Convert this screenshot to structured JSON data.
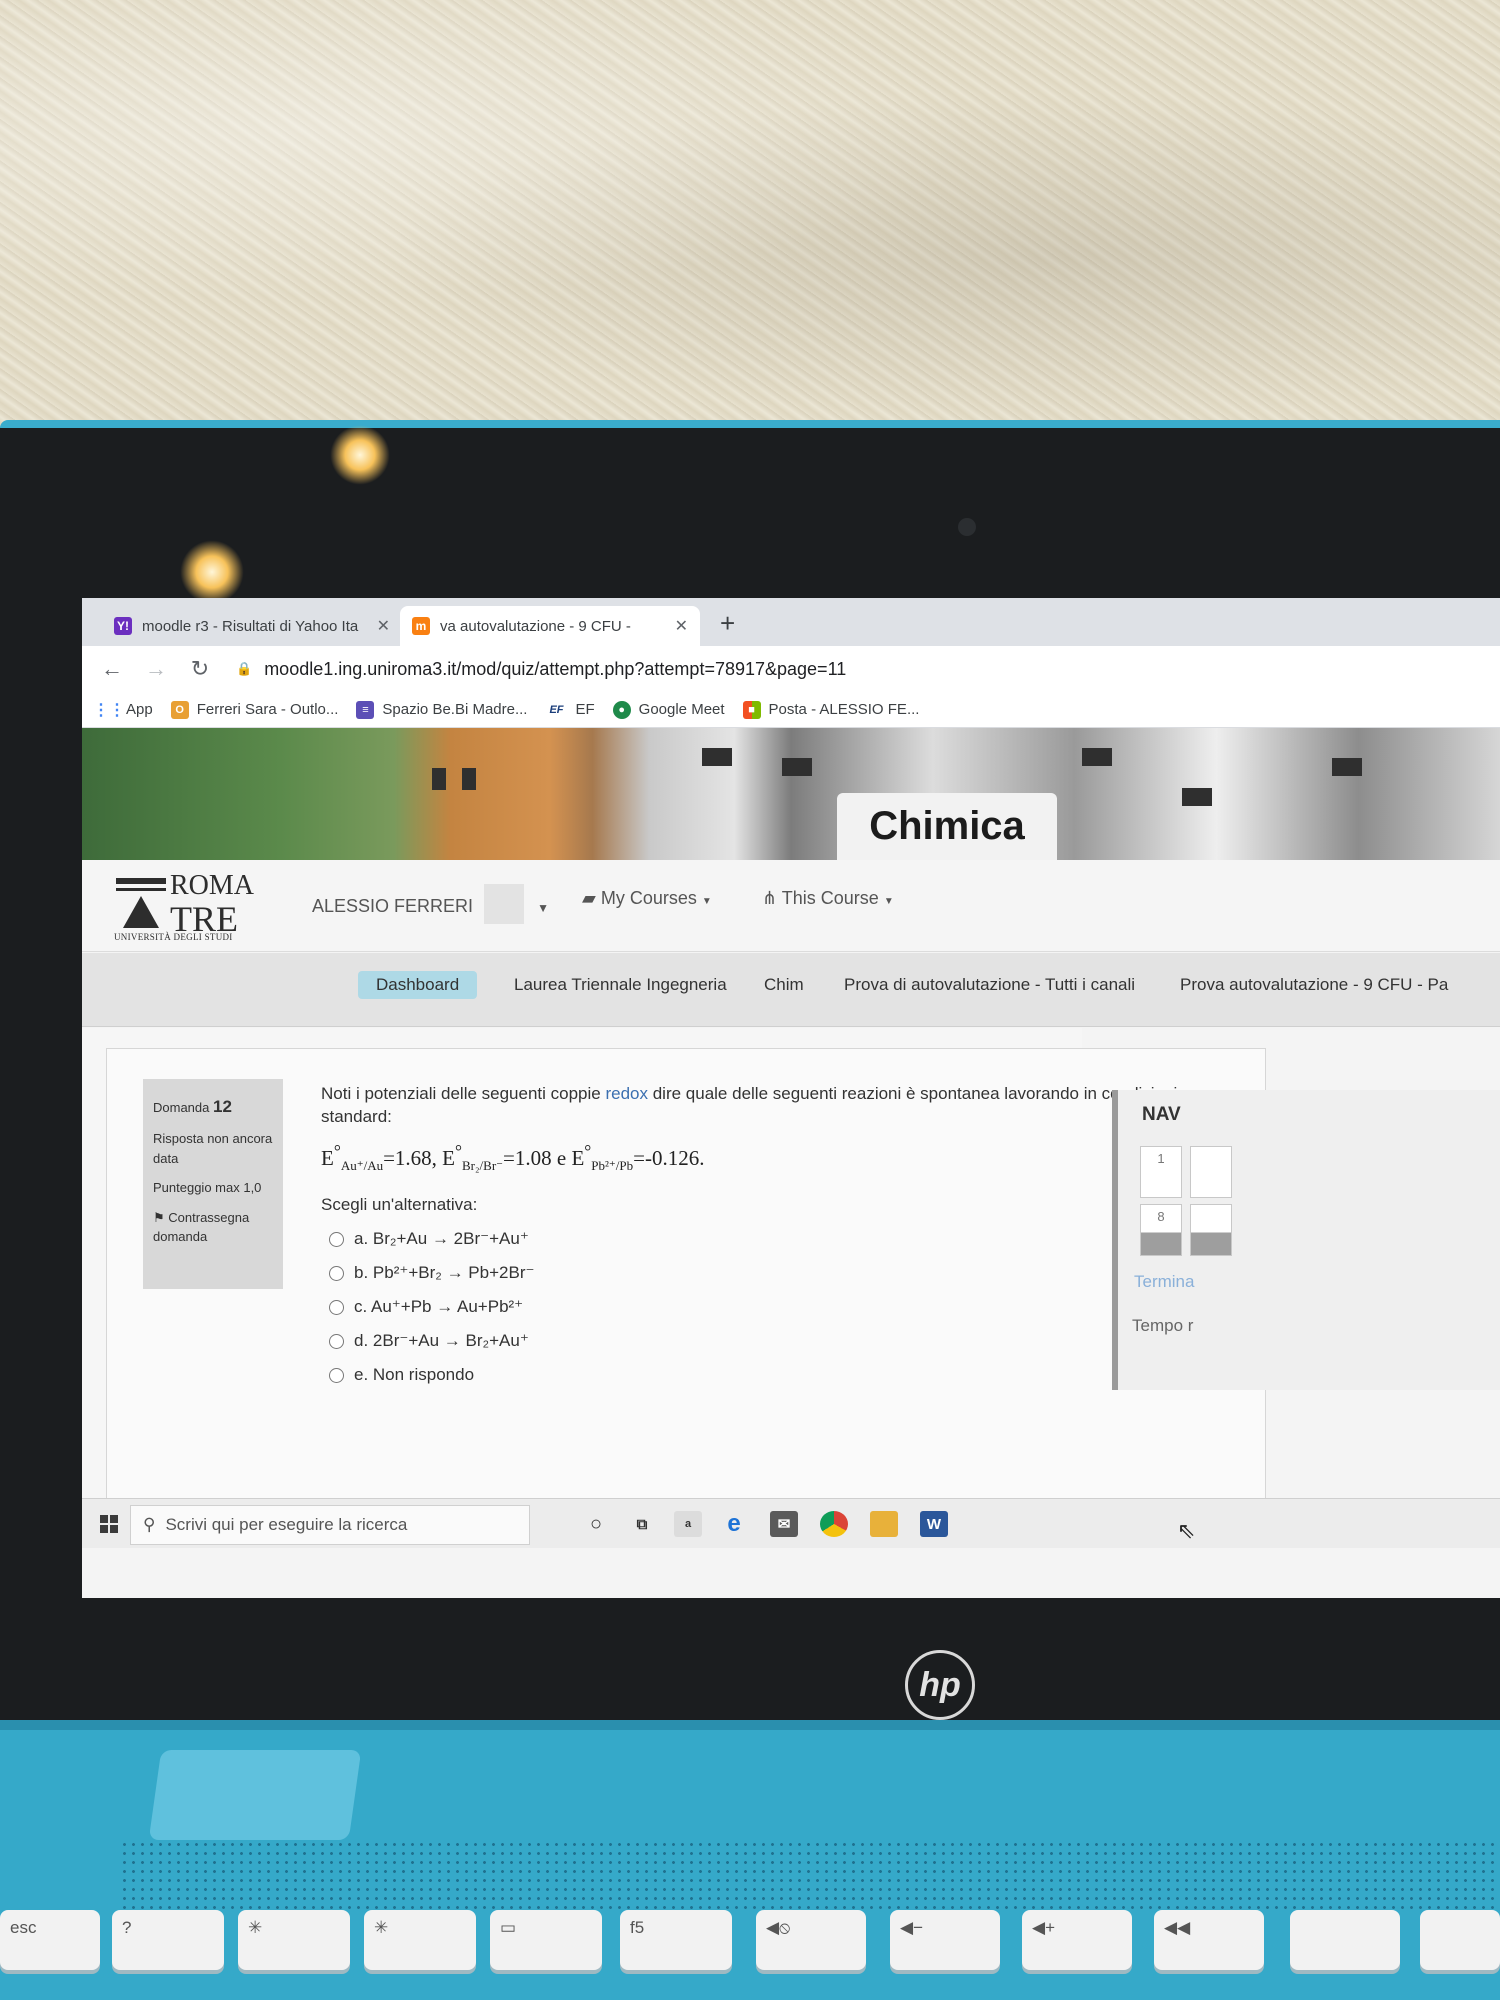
{
  "browser": {
    "tabs": [
      {
        "label": "moodle r3 - Risultati di Yahoo Ita",
        "favicon": "yahoo-icon"
      },
      {
        "label": "va autovalutazione - 9 CFU - ",
        "favicon": "moodle-icon"
      }
    ],
    "new_tab": "+",
    "url": "moodle1.ing.uniroma3.it/mod/quiz/attempt.php?attempt=78917&page=11",
    "bookmarks": [
      {
        "label": "App",
        "icon": "apps-grid-icon"
      },
      {
        "label": "Ferreri Sara - Outlo...",
        "icon": "outlook-icon"
      },
      {
        "label": "Spazio Be.Bi Madre...",
        "icon": "list-icon"
      },
      {
        "label": "EF",
        "icon": "ef-icon"
      },
      {
        "label": "Google Meet",
        "icon": "meet-icon"
      },
      {
        "label": "Posta - ALESSIO FE...",
        "icon": "microsoft-icon"
      }
    ]
  },
  "header": {
    "course_title": "Chimica",
    "logo": {
      "line1": "ROMA",
      "line2": "TRE",
      "sub": "UNIVERSITÀ DEGLI STUDI"
    },
    "user": "ALESSIO FERRERI",
    "my_courses": "My Courses",
    "this_course": "This Course"
  },
  "breadcrumb": [
    "Dashboard",
    "Laurea Triennale Ingegneria",
    "Chim",
    "Prova di autovalutazione - Tutti i canali",
    "Prova autovalutazione - 9 CFU - Pa"
  ],
  "question": {
    "label": "Domanda",
    "number": "12",
    "status": "Risposta non ancora data",
    "max_score": "Punteggio max 1,0",
    "flag": "Contrassegna domanda",
    "text_before": "Noti i potenziali delle seguenti coppie ",
    "text_link": "redox",
    "text_after": " dire quale delle seguenti reazioni è spontanea lavorando in condizioni standard:",
    "formula": {
      "e1_sub": "Au⁺/Au",
      "e1_val": "=1.68, ",
      "e2_sub": "Br₂/Br⁻",
      "e2_val": "=1.08 e ",
      "e3_sub": "Pb²⁺/Pb",
      "e3_val": "=-0.126."
    },
    "prompt": "Scegli un'alternativa:",
    "options": [
      "a. Br₂+Au → 2Br⁻+Au⁺",
      "b. Pb²⁺+Br₂ → Pb+2Br⁻",
      "c. Au⁺+Pb → Au+Pb²⁺",
      "d. 2Br⁻+Au → Br₂+Au⁺",
      "e. Non rispondo"
    ]
  },
  "quiz_nav": {
    "title": "NAV",
    "boxes": [
      "1",
      "8"
    ],
    "finish": "Termina",
    "time": "Tempo r"
  },
  "taskbar": {
    "search_placeholder": "Scrivi qui per eseguire la ricerca"
  },
  "keyboard": {
    "keys": [
      "esc",
      "?",
      "✳",
      "✳",
      "▭",
      "f5",
      "◀⦸",
      "◀−",
      "◀+",
      "◀◀"
    ],
    "brand": "hp"
  }
}
